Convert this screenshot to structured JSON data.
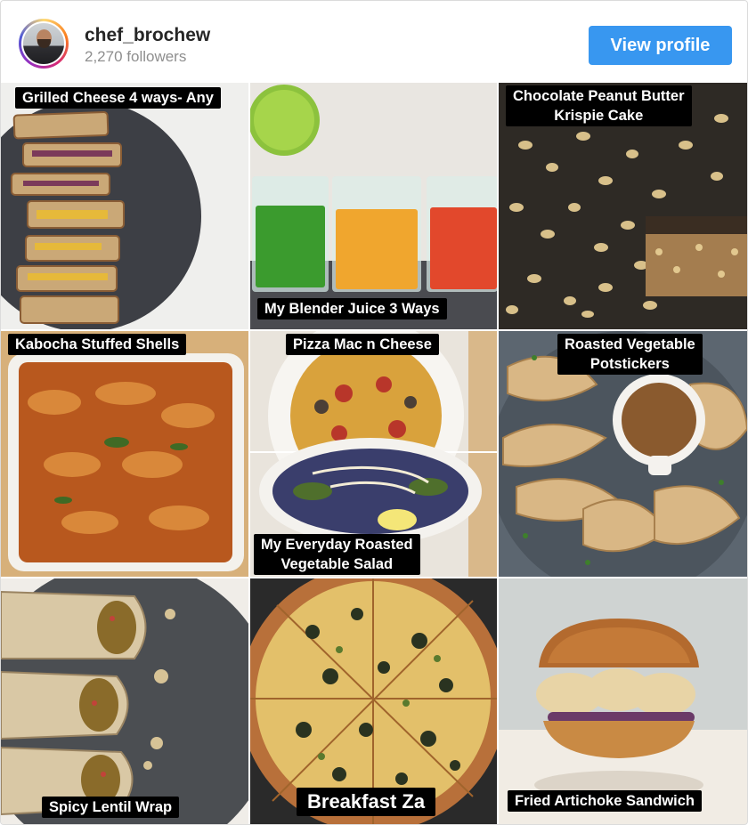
{
  "profile": {
    "username": "chef_brochew",
    "followers": "2,270 followers",
    "view_profile_label": "View profile"
  },
  "posts": [
    {
      "caption_lines": [
        "Grilled Cheese 4 ways- Any"
      ]
    },
    {
      "caption_lines": [
        "My Blender Juice 3 Ways"
      ]
    },
    {
      "caption_lines": [
        "Chocolate Peanut Butter",
        "Krispie Cake"
      ]
    },
    {
      "caption_lines": [
        "Kabocha Stuffed Shells"
      ]
    },
    {
      "caption_lines": [
        "Pizza Mac n Cheese"
      ],
      "caption2_lines": [
        "My Everyday Roasted",
        "Vegetable Salad"
      ]
    },
    {
      "caption_lines": [
        "Roasted Vegetable",
        "Potstickers"
      ]
    },
    {
      "caption_lines": [
        "Spicy Lentil Wrap"
      ]
    },
    {
      "caption_lines": [
        "Breakfast Za"
      ]
    },
    {
      "caption_lines": [
        "Fried Artichoke Sandwich"
      ]
    }
  ]
}
